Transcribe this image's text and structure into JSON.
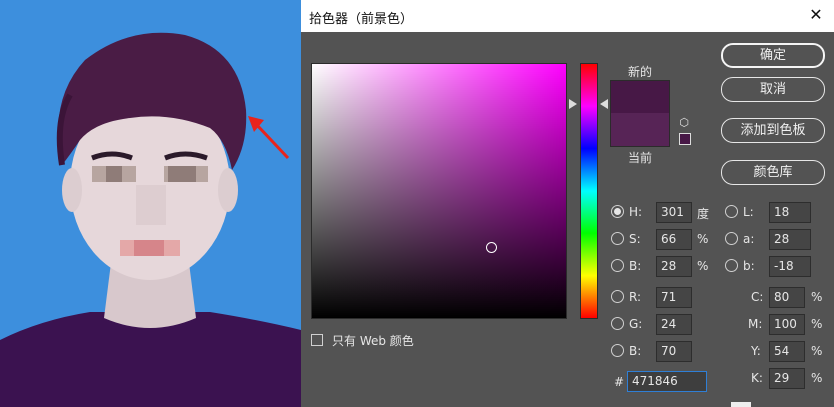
{
  "dialog": {
    "title": "拾色器（前景色）",
    "close_glyph": "✕",
    "buttons": {
      "ok": "确定",
      "cancel": "取消",
      "add_swatch": "添加到色板",
      "libraries": "颜色库"
    },
    "new_label": "新的",
    "current_label": "当前",
    "web_only_label": "只有 Web 颜色",
    "colors": {
      "new": "#471846",
      "current": "#572456"
    }
  },
  "hsb": {
    "h": {
      "label": "H:",
      "value": "301",
      "unit": "度"
    },
    "s": {
      "label": "S:",
      "value": "66",
      "unit": "%"
    },
    "b": {
      "label": "B:",
      "value": "28",
      "unit": "%"
    }
  },
  "rgb": {
    "r": {
      "label": "R:",
      "value": "71"
    },
    "g": {
      "label": "G:",
      "value": "24"
    },
    "b": {
      "label": "B:",
      "value": "70"
    }
  },
  "lab": {
    "l": {
      "label": "L:",
      "value": "18"
    },
    "a": {
      "label": "a:",
      "value": "28"
    },
    "b": {
      "label": "b:",
      "value": "-18"
    }
  },
  "cmyk": {
    "c": {
      "label": "C:",
      "value": "80",
      "unit": "%"
    },
    "m": {
      "label": "M:",
      "value": "100",
      "unit": "%"
    },
    "y": {
      "label": "Y:",
      "value": "54",
      "unit": "%"
    },
    "k": {
      "label": "K:",
      "value": "29",
      "unit": "%"
    }
  },
  "hex": {
    "label": "#",
    "value": "471846"
  },
  "photo": {
    "background_color": "#3d8fdd",
    "annotation_color": "#e8241c"
  }
}
